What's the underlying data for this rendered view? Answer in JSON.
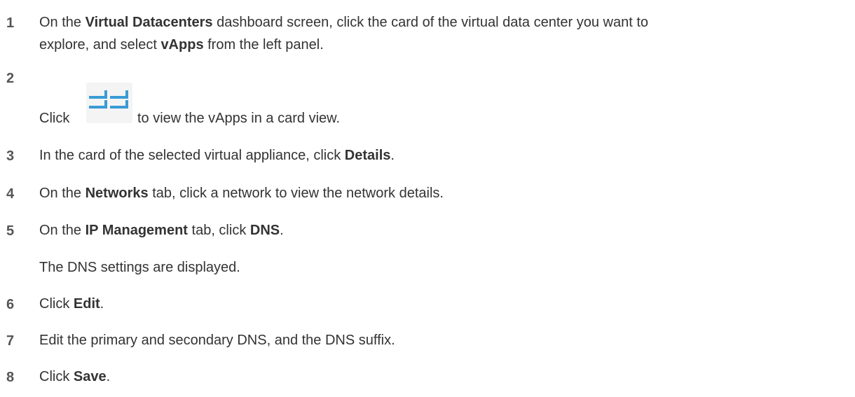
{
  "steps": [
    {
      "number": "1",
      "lines": [
        {
          "parts": [
            "On the ",
            "Virtual Datacenters",
            " dashboard screen, click the card of the virtual data center you want to"
          ]
        },
        {
          "parts": [
            "explore, and select ",
            "vApps",
            " from the left panel."
          ]
        }
      ]
    },
    {
      "number": "2",
      "icon": "card-view-icon",
      "lines": [
        {
          "parts": [
            "Click",
            "to view the vApps in a card view."
          ]
        }
      ]
    },
    {
      "number": "3",
      "lines": [
        {
          "parts": [
            "In the card of the selected virtual appliance, click ",
            "Details",
            "."
          ]
        }
      ]
    },
    {
      "number": "4",
      "lines": [
        {
          "parts": [
            "On the ",
            "Networks",
            " tab, click a network to view the network details."
          ]
        }
      ]
    },
    {
      "number": "5",
      "lines": [
        {
          "parts": [
            "On the ",
            "IP Management",
            " tab, click ",
            "DNS",
            "."
          ]
        },
        {
          "parts": [
            "The DNS settings are displayed."
          ]
        }
      ]
    },
    {
      "number": "6",
      "lines": [
        {
          "parts": [
            "Click ",
            "Edit",
            "."
          ]
        }
      ]
    },
    {
      "number": "7",
      "lines": [
        {
          "parts": [
            "Edit the primary and secondary DNS, and the DNS suffix."
          ]
        }
      ]
    },
    {
      "number": "8",
      "lines": [
        {
          "parts": [
            "Click ",
            "Save",
            "."
          ]
        }
      ]
    }
  ],
  "colors": {
    "text": "#333333",
    "number": "#555555",
    "icon_blue": "#3a9bd5"
  }
}
